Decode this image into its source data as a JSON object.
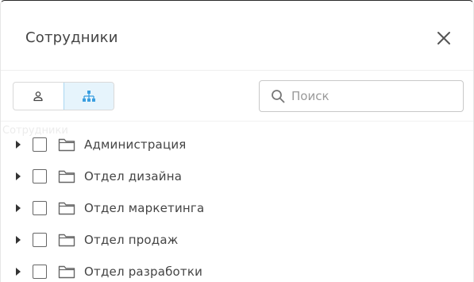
{
  "dialog": {
    "title": "Сотрудники",
    "close_icon": "close-icon"
  },
  "toolbar": {
    "view_toggle": {
      "options": [
        {
          "icon": "person-icon",
          "active": false
        },
        {
          "icon": "org-structure-icon",
          "active": true
        }
      ]
    },
    "search": {
      "placeholder": "Поиск",
      "value": "",
      "icon": "search-icon"
    }
  },
  "ghost_label": "Сотрудники",
  "tree": {
    "items": [
      {
        "label": "Администрация",
        "checked": false,
        "expanded": false
      },
      {
        "label": "Отдел дизайна",
        "checked": false,
        "expanded": false
      },
      {
        "label": "Отдел маркетинга",
        "checked": false,
        "expanded": false
      },
      {
        "label": "Отдел продаж",
        "checked": false,
        "expanded": false
      },
      {
        "label": "Отдел разработки",
        "checked": false,
        "expanded": false
      }
    ]
  },
  "colors": {
    "accent": "#3a9fe0",
    "accent_bg": "#e6f4fc",
    "border": "#d9d9d9",
    "text": "#444444",
    "placeholder": "#9a9a9a"
  }
}
